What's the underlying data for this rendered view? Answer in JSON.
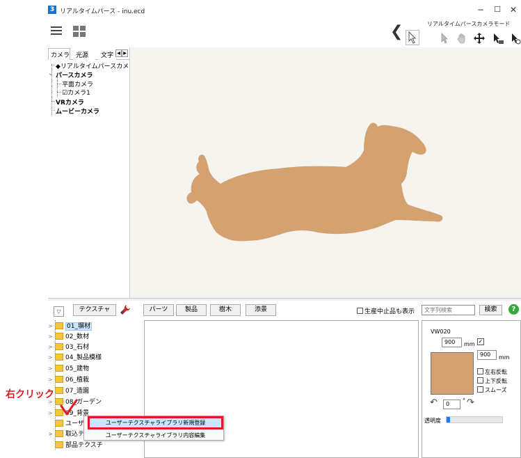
{
  "window": {
    "app_icon": "3",
    "title": "リアルタイムパース - inu.ecd",
    "minimize_glyph": "−",
    "maximize_glyph": "☐",
    "close_glyph": "✕"
  },
  "toolbar": {
    "menu_icon": "hamburger-icon",
    "layout_icon": "grid-icon",
    "back_icon": "chevron-left-icon",
    "camera_mode_label": "リアルタイムパースカメラモード",
    "tools": [
      "select-cursor-icon",
      "pointer-icon",
      "hand-icon",
      "move-icon",
      "zoom-cursor-icon",
      "camera-cursor-icon"
    ]
  },
  "left_panel": {
    "tabs": [
      "カメラ",
      "光源",
      "文字"
    ],
    "tree": [
      {
        "label": "◆リアルタイムパースカメラ",
        "bold": false
      },
      {
        "label": "パースカメラ",
        "bold": true
      },
      {
        "label": "平面カメラ",
        "bold": false
      },
      {
        "label": "☑カメラ1",
        "bold": false
      },
      {
        "label": "VRカメラ",
        "bold": true
      },
      {
        "label": "ムービーカメラ",
        "bold": true
      }
    ]
  },
  "viewport": {
    "subject": "dog-silhouette",
    "fill_color": "#D4A171",
    "background_color": "#F6F4EE"
  },
  "bottom_toolbar": {
    "filter_glyph": "▽",
    "texture_button": "テクスチャ",
    "parts_button": "パーツ",
    "products_button": "製品",
    "trees_button": "樹木",
    "landscape_button": "添景",
    "discontinued_label": "生産中止品も表示",
    "search_placeholder": "文字列検索",
    "search_button": "検索",
    "help_glyph": "?"
  },
  "texture_tree": [
    {
      "label": "01_塀材",
      "selected": true
    },
    {
      "label": "02_数材",
      "selected": false
    },
    {
      "label": "03_石材",
      "selected": false
    },
    {
      "label": "04_製品模様",
      "selected": false
    },
    {
      "label": "05_建物",
      "selected": false
    },
    {
      "label": "06_植栽",
      "selected": false
    },
    {
      "label": "07_造園",
      "selected": false
    },
    {
      "label": "08_ガーデン",
      "selected": false
    },
    {
      "label": "09_背景",
      "selected": false
    },
    {
      "label": "ユーザ",
      "selected": false
    },
    {
      "label": "取込テ",
      "selected": false
    },
    {
      "label": "部品テクスチ",
      "selected": false
    }
  ],
  "properties": {
    "texture_code": "VW020",
    "width_value": "900",
    "width_unit": "mm",
    "height_value": "900",
    "height_unit": "mm",
    "flip_horizontal": "左右反転",
    "flip_vertical": "上下反転",
    "smooth": "スムーズ",
    "rotation_value": "0",
    "rotation_unit": "°",
    "opacity_label": "透明度",
    "opacity_fraction": 0.06,
    "swatch_color": "#D4A171"
  },
  "context_menu": {
    "item_new": "ユーザーテクスチャライブラリ新規登録",
    "item_edit": "ユーザーテクスチャライブラリ内容編集"
  },
  "annotation": {
    "text": "右クリック",
    "color": "#E01B24"
  }
}
